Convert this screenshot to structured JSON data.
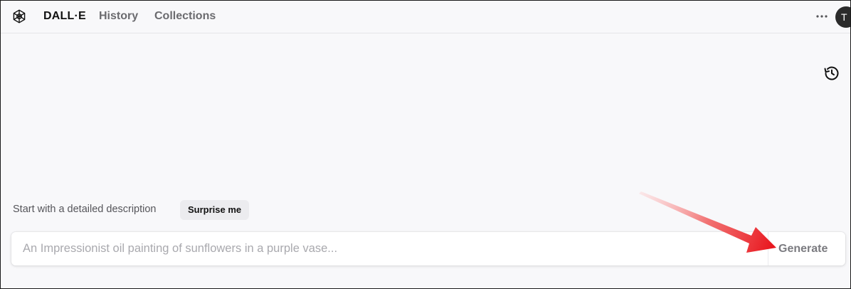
{
  "header": {
    "brand": "DALL·E",
    "nav": [
      {
        "label": "History"
      },
      {
        "label": "Collections"
      }
    ],
    "avatar_initial": "T",
    "more_icon": "more-horizontal-icon",
    "logo_icon": "openai-logo-icon"
  },
  "main": {
    "history_icon": "history-icon",
    "prompt_label": "Start with a detailed description",
    "surprise_label": "Surprise me",
    "input": {
      "value": "",
      "placeholder": "An Impressionist oil painting of sunflowers in a purple vase..."
    },
    "generate_label": "Generate"
  },
  "annotation": {
    "type": "arrow",
    "color": "#e8121a"
  },
  "colors": {
    "background": "#f8f8fa",
    "avatar_bg": "#2b2b2b",
    "chip_bg": "#ececef"
  }
}
